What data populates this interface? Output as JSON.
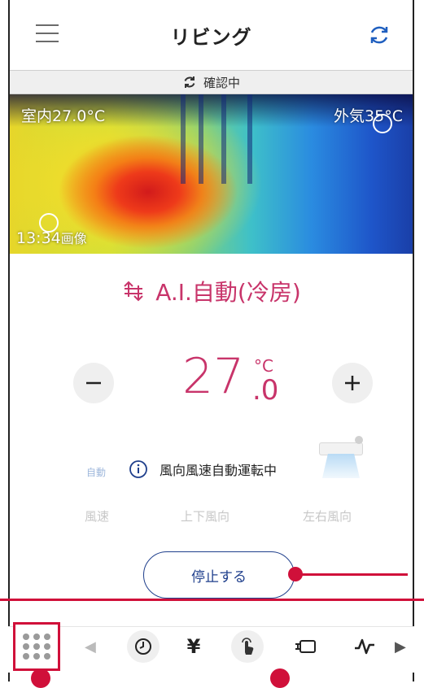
{
  "header": {
    "title": "リビング",
    "menu_icon": "hamburger-menu-icon",
    "refresh_icon": "refresh-icon"
  },
  "status": {
    "text": "確認中",
    "icon": "sync-icon"
  },
  "thermal": {
    "indoor_label": "室内",
    "indoor_temp": "27.0°C",
    "outdoor_label": "外気",
    "outdoor_temp": "35°C",
    "time": "13:34",
    "time_suffix": "画像"
  },
  "mode": {
    "label": "A.I.自動(冷房)",
    "icon": "auto-swap-arrows-icon"
  },
  "temperature": {
    "integer": "27",
    "decimal": ".0",
    "unit": "°C",
    "minus_icon": "minus-icon",
    "plus_icon": "plus-icon"
  },
  "wind": {
    "auto_label": "自動",
    "notice": "風向風速自動運転中",
    "speed_label": "風速",
    "vertical_label": "上下風向",
    "horizontal_label": "左右風向"
  },
  "stop_button": {
    "label": "停止する"
  },
  "toolbar": {
    "items": [
      "grid-menu-icon",
      "timer-icon",
      "yen-icon",
      "touch-hand-icon",
      "indoor-unit-icon",
      "graph-icon"
    ],
    "yen_glyph": "¥"
  },
  "colors": {
    "accent": "#c8346a",
    "primary_blue": "#1f3f8c",
    "callout_red": "#d0103a"
  }
}
